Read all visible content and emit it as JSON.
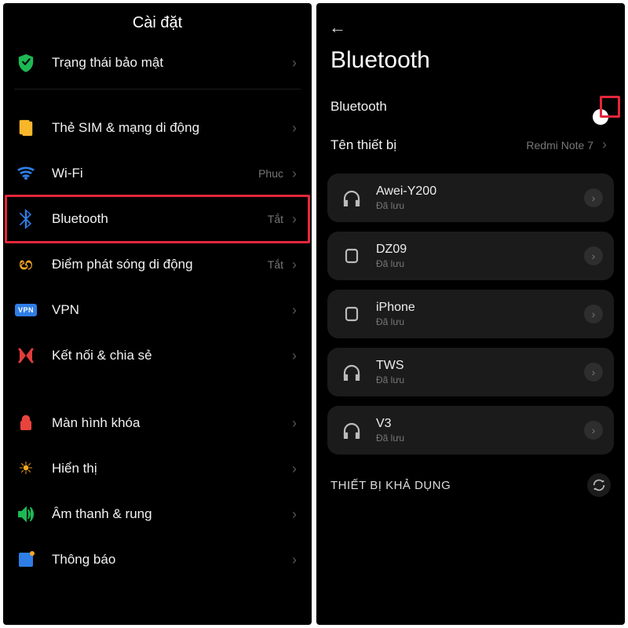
{
  "left": {
    "title": "Cài đặt",
    "items": [
      {
        "key": "security",
        "label": "Trạng thái bảo mật",
        "value": ""
      },
      {
        "key": "sim",
        "label": "Thẻ SIM & mạng di động",
        "value": ""
      },
      {
        "key": "wifi",
        "label": "Wi-Fi",
        "value": "Phuc"
      },
      {
        "key": "bluetooth",
        "label": "Bluetooth",
        "value": "Tắt"
      },
      {
        "key": "hotspot",
        "label": "Điểm phát sóng di động",
        "value": "Tắt"
      },
      {
        "key": "vpn",
        "label": "VPN",
        "value": ""
      },
      {
        "key": "share",
        "label": "Kết nối & chia sẻ",
        "value": ""
      },
      {
        "key": "lock",
        "label": "Màn hình khóa",
        "value": ""
      },
      {
        "key": "display",
        "label": "Hiển thị",
        "value": ""
      },
      {
        "key": "sound",
        "label": "Âm thanh & rung",
        "value": ""
      },
      {
        "key": "notif",
        "label": "Thông báo",
        "value": ""
      }
    ]
  },
  "right": {
    "title": "Bluetooth",
    "toggle_label": "Bluetooth",
    "toggle_on": true,
    "device_name_label": "Tên thiết bị",
    "device_name_value": "Redmi Note 7",
    "devices": [
      {
        "name": "Awei-Y200",
        "sub": "Đã lưu",
        "kind": "headphones"
      },
      {
        "name": "DZ09",
        "sub": "Đã lưu",
        "kind": "watch"
      },
      {
        "name": "iPhone",
        "sub": "Đã lưu",
        "kind": "watch"
      },
      {
        "name": "TWS",
        "sub": "Đã lưu",
        "kind": "headphones"
      },
      {
        "name": "V3",
        "sub": "Đã lưu",
        "kind": "headphones"
      }
    ],
    "available_label": "THIẾT BỊ KHẢ DỤNG"
  },
  "colors": {
    "highlight": "#e3263b",
    "accent": "#1178d4"
  }
}
